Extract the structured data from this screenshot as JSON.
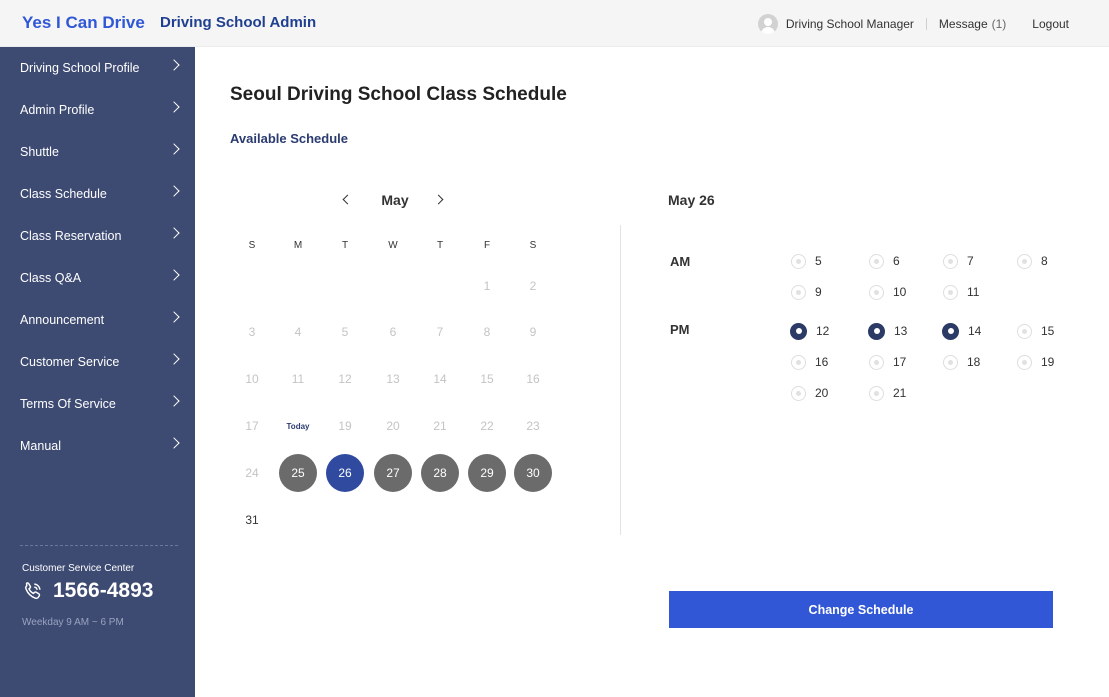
{
  "header": {
    "brand": "Yes I Can Drive",
    "title": "Driving School Admin",
    "user_role": "Driving School Manager",
    "message_label": "Message",
    "message_count": "(1)",
    "logout_label": "Logout"
  },
  "sidebar": {
    "items": [
      {
        "label": "Driving School Profile"
      },
      {
        "label": "Admin Profile"
      },
      {
        "label": "Shuttle"
      },
      {
        "label": "Class Schedule"
      },
      {
        "label": "Class Reservation"
      },
      {
        "label": "Class Q&A"
      },
      {
        "label": "Announcement"
      },
      {
        "label": "Customer Service"
      },
      {
        "label": "Terms Of Service"
      },
      {
        "label": "Manual"
      }
    ],
    "customer_service": {
      "title": "Customer Service Center",
      "phone": "1566-4893",
      "hours": "Weekday 9 AM ~ 6 PM"
    }
  },
  "main": {
    "page_title": "Seoul Driving School Class Schedule",
    "section_title": "Available Schedule",
    "calendar": {
      "month": "May",
      "weekdays": [
        "S",
        "M",
        "T",
        "W",
        "T",
        "F",
        "S"
      ],
      "weeks": [
        [
          null,
          null,
          null,
          null,
          null,
          {
            "label": "1"
          },
          {
            "label": "2"
          }
        ],
        [
          {
            "label": "3"
          },
          {
            "label": "4"
          },
          {
            "label": "5"
          },
          {
            "label": "6"
          },
          {
            "label": "7"
          },
          {
            "label": "8"
          },
          {
            "label": "9"
          }
        ],
        [
          {
            "label": "10"
          },
          {
            "label": "11"
          },
          {
            "label": "12"
          },
          {
            "label": "13"
          },
          {
            "label": "14"
          },
          {
            "label": "15"
          },
          {
            "label": "16"
          }
        ],
        [
          {
            "label": "17"
          },
          {
            "label": "Today",
            "state": "today"
          },
          {
            "label": "19"
          },
          {
            "label": "20"
          },
          {
            "label": "21"
          },
          {
            "label": "22"
          },
          {
            "label": "23"
          }
        ],
        [
          {
            "label": "24"
          },
          {
            "label": "25",
            "state": "available"
          },
          {
            "label": "26",
            "state": "selected"
          },
          {
            "label": "27",
            "state": "available"
          },
          {
            "label": "28",
            "state": "available"
          },
          {
            "label": "29",
            "state": "available"
          },
          {
            "label": "30",
            "state": "available"
          }
        ],
        [
          {
            "label": "31",
            "state": "plain"
          },
          null,
          null,
          null,
          null,
          null,
          null
        ]
      ]
    },
    "schedule": {
      "selected_date": "May 26",
      "am_label": "AM",
      "pm_label": "PM",
      "am_slots": [
        {
          "label": "5",
          "checked": false
        },
        {
          "label": "6",
          "checked": false
        },
        {
          "label": "7",
          "checked": false
        },
        {
          "label": "8",
          "checked": false
        },
        {
          "label": "9",
          "checked": false
        },
        {
          "label": "10",
          "checked": false
        },
        {
          "label": "11",
          "checked": false
        }
      ],
      "pm_slots": [
        {
          "label": "12",
          "checked": true
        },
        {
          "label": "13",
          "checked": true
        },
        {
          "label": "14",
          "checked": true
        },
        {
          "label": "15",
          "checked": false
        },
        {
          "label": "16",
          "checked": false
        },
        {
          "label": "17",
          "checked": false
        },
        {
          "label": "18",
          "checked": false
        },
        {
          "label": "19",
          "checked": false
        },
        {
          "label": "20",
          "checked": false
        },
        {
          "label": "21",
          "checked": false
        }
      ]
    },
    "change_button_label": "Change Schedule"
  },
  "colors": {
    "brand": "#2f57d6",
    "sidebar_bg": "#3d4a72",
    "selected_day": "#2f4a9e",
    "available_day": "#6b6b6b",
    "primary_button": "#3257d6",
    "checked_radio": "#2c3a66"
  },
  "icons": {
    "user": "user-avatar-icon",
    "phone": "phone-icon",
    "chevron": "chevron-right-icon",
    "prev_month": "chevron-left-icon",
    "next_month": "chevron-right-icon"
  }
}
